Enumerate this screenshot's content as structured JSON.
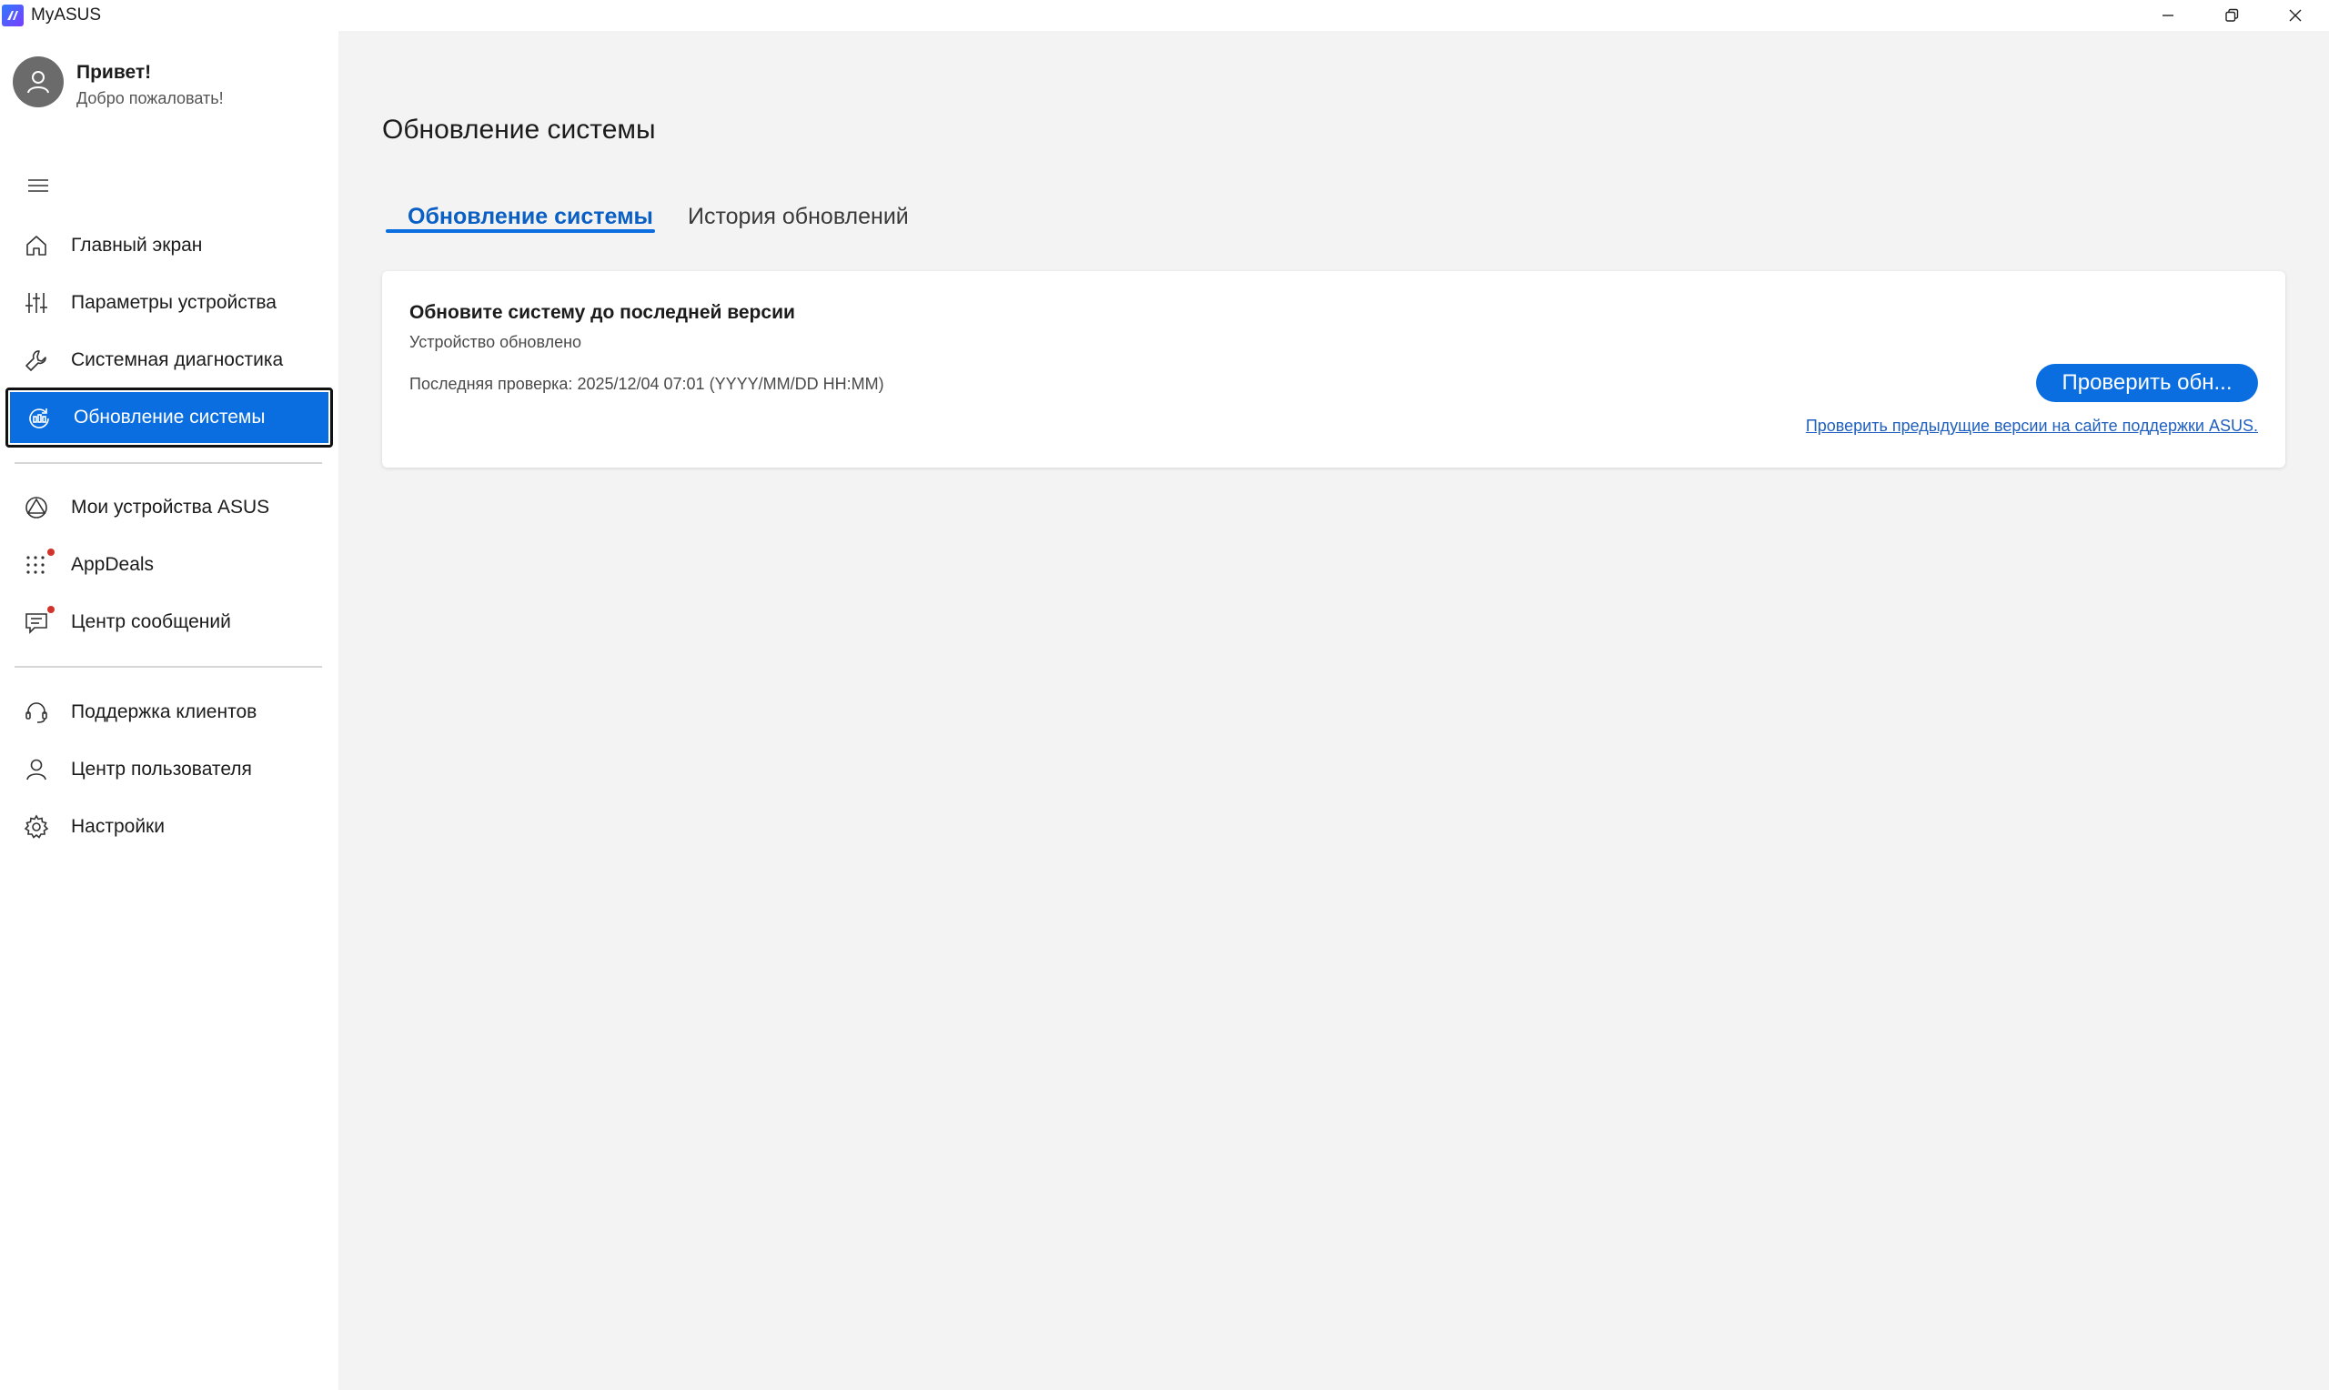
{
  "window": {
    "title": "MyASUS",
    "controls": [
      "minimize-icon",
      "restore-icon",
      "close-icon"
    ]
  },
  "profile": {
    "greeting": "Привет!",
    "welcome": "Добро пожаловать!"
  },
  "sidebar": {
    "menu_icon": "hamburger-icon",
    "groups": [
      {
        "items": [
          {
            "label": "Главный экран",
            "icon": "home-icon"
          },
          {
            "label": "Параметры устройства",
            "icon": "sliders-icon"
          },
          {
            "label": "Системная диагностика",
            "icon": "wrench-icon"
          },
          {
            "label": "Обновление системы",
            "icon": "update-icon",
            "active": true
          }
        ]
      },
      {
        "items": [
          {
            "label": "Мои устройства ASUS",
            "icon": "devices-icon"
          },
          {
            "label": "AppDeals",
            "icon": "apps-grid-icon",
            "badge": true
          },
          {
            "label": "Центр сообщений",
            "icon": "message-icon",
            "badge": true
          }
        ]
      },
      {
        "items": [
          {
            "label": "Поддержка клиентов",
            "icon": "headset-icon"
          },
          {
            "label": "Центр пользователя",
            "icon": "user-icon"
          },
          {
            "label": "Настройки",
            "icon": "gear-icon"
          }
        ]
      }
    ]
  },
  "main": {
    "title": "Обновление системы",
    "tabs": [
      {
        "label": "Обновление системы",
        "selected": true
      },
      {
        "label": "История обновлений",
        "selected": false
      }
    ],
    "card": {
      "title": "Обновите систему до последней версии",
      "status": "Устройство обновлено",
      "last_check": "Последняя проверка: 2025/12/04 07:01 (YYYY/MM/DD HH:MM)",
      "check_button": "Проверить обн...",
      "support_link": "Проверить предыдущие версии на сайте поддержки ASUS."
    }
  },
  "colors": {
    "accent": "#0a6ee0",
    "tab_selected_text": "#0a5fc4",
    "badge": "#d1342c",
    "main_bg": "#f3f3f3"
  }
}
